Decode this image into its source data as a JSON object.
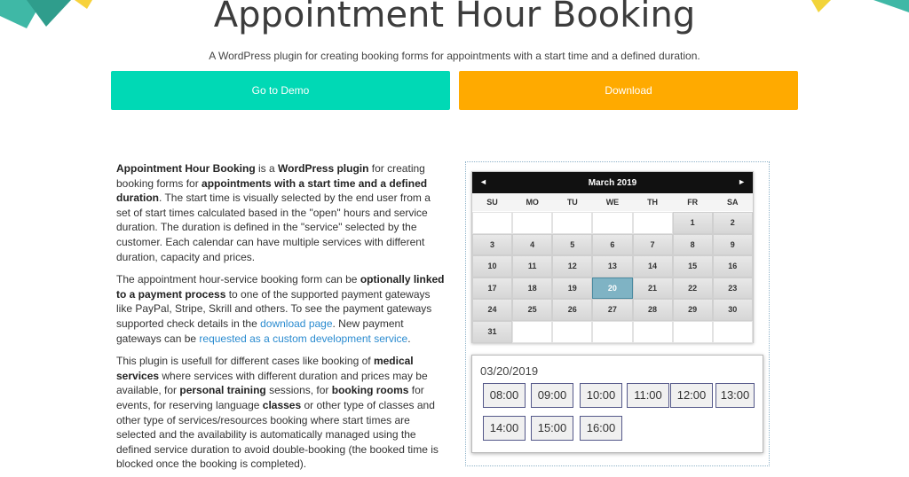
{
  "colors": {
    "demo_button": "#00d9b5",
    "download_button": "#ffaa00",
    "link": "#2a8bd0",
    "selected_day": "#7fb3c4"
  },
  "header": {
    "title": "Appointment Hour Booking",
    "subtitle": "A WordPress plugin for creating booking forms for appointments with a start time and a defined duration."
  },
  "buttons": {
    "demo_label": "Go to Demo",
    "download_label": "Download"
  },
  "description": {
    "p1": [
      {
        "t": "Appointment Hour Booking",
        "b": true
      },
      {
        "t": " is a "
      },
      {
        "t": "WordPress plugin",
        "b": true
      },
      {
        "t": " for creating booking forms for "
      },
      {
        "t": "appointments with a start time and a defined duration",
        "b": true
      },
      {
        "t": ". The start time is visually selected by the end user from a set of start times calculated based in the \"open\" hours and service duration. The duration is defined in the \"service\" selected by the customer. Each calendar can have multiple services with different duration, capacity and prices."
      }
    ],
    "p2": [
      {
        "t": "The appointment hour-service booking form can be "
      },
      {
        "t": "optionally linked to a payment process",
        "b": true
      },
      {
        "t": " to one of the supported payment gateways like PayPal, Stripe, Skrill and others. To see the payment gateways supported check details in the "
      },
      {
        "t": "download page",
        "link": true
      },
      {
        "t": ". New payment gateways can be "
      },
      {
        "t": "requested as a custom development service",
        "link": true
      },
      {
        "t": "."
      }
    ],
    "p3": [
      {
        "t": "This plugin is usefull for different cases like booking of "
      },
      {
        "t": "medical services",
        "b": true
      },
      {
        "t": " where services with different duration and prices may be available, for "
      },
      {
        "t": "personal training",
        "b": true
      },
      {
        "t": " sessions, for "
      },
      {
        "t": "booking rooms",
        "b": true
      },
      {
        "t": " for events, for reserving language "
      },
      {
        "t": "classes",
        "b": true
      },
      {
        "t": " or other type of classes and other type of services/resources booking where start times are selected and the availability is automatically managed using the defined service duration to avoid double-booking (the booked time is blocked once the booking is completed)."
      }
    ]
  },
  "calendar": {
    "month_label": "March 2019",
    "prev_icon": "◄",
    "next_icon": "►",
    "days_of_week": [
      "SU",
      "MO",
      "TU",
      "WE",
      "TH",
      "FR",
      "SA"
    ],
    "weeks": [
      [
        "",
        "",
        "",
        "",
        "",
        "1",
        "2"
      ],
      [
        "3",
        "4",
        "5",
        "6",
        "7",
        "8",
        "9"
      ],
      [
        "10",
        "11",
        "12",
        "13",
        "14",
        "15",
        "16"
      ],
      [
        "17",
        "18",
        "19",
        "20",
        "21",
        "22",
        "23"
      ],
      [
        "24",
        "25",
        "26",
        "27",
        "28",
        "29",
        "30"
      ],
      [
        "31",
        "",
        "",
        "",
        "",
        "",
        ""
      ]
    ],
    "selected_day": "20"
  },
  "slots": {
    "selected_date": "03/20/2019",
    "times": [
      "08:00",
      "09:00",
      "10:00",
      "11:00",
      "12:00",
      "13:00",
      "14:00",
      "15:00",
      "16:00"
    ]
  }
}
